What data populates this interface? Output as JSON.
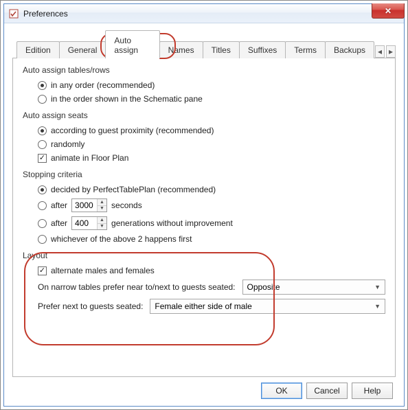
{
  "window": {
    "title": "Preferences",
    "close_glyph": "✕"
  },
  "tabs": {
    "items": [
      "Edition",
      "General",
      "Auto assign",
      "Names",
      "Titles",
      "Suffixes",
      "Terms",
      "Backups"
    ],
    "active_index": 2,
    "scroll_left": "◂",
    "scroll_right": "▸"
  },
  "group_tables": {
    "title": "Auto assign tables/rows",
    "opt1": "in any order (recommended)",
    "opt2": "in the order shown in the Schematic pane",
    "selected": 0
  },
  "group_seats": {
    "title": "Auto assign seats",
    "opt1": "according to guest proximity (recommended)",
    "opt2": "randomly",
    "chk_label": "animate in Floor Plan",
    "selected": 0,
    "animate_checked": true
  },
  "group_stopping": {
    "title": "Stopping criteria",
    "opt1": "decided by PerfectTablePlan (recommended)",
    "opt2_prefix": "after",
    "opt2_value": "3000",
    "opt2_suffix": "seconds",
    "opt3_prefix": "after",
    "opt3_value": "400",
    "opt3_suffix": "generations without improvement",
    "opt4": "whichever of the above 2 happens first",
    "selected": 0,
    "spin_up": "▲",
    "spin_down": "▼"
  },
  "group_layout": {
    "title": "Layout",
    "chk_label": "alternate males and females",
    "chk_checked": true,
    "row1_label": "On narrow tables prefer near to/next to guests seated:",
    "row1_value": "Opposite",
    "row2_label": "Prefer next to guests seated:",
    "row2_value": "Female either side of male",
    "combo_arrow": "▼"
  },
  "footer": {
    "ok": "OK",
    "cancel": "Cancel",
    "help": "Help"
  }
}
